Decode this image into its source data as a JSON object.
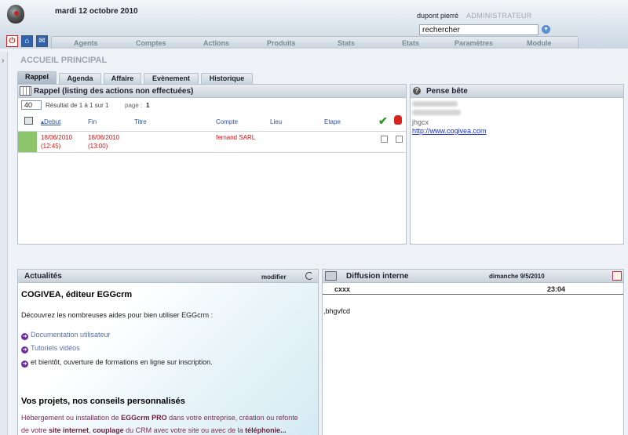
{
  "header": {
    "date": "mardi 12 octobre 2010",
    "user": "dupont pierré",
    "role": "ADMINISTRATEUR",
    "search_value": "rechercher"
  },
  "nav": [
    "Agents",
    "Comptes",
    "Actions",
    "Produits",
    "Stats",
    "Etats",
    "Paramètres",
    "Module"
  ],
  "page_title": "ACCUEIL PRINCIPAL",
  "tabs": [
    "Rappel",
    "Agenda",
    "Affaire",
    "Evènement",
    "Historique"
  ],
  "rappel": {
    "title": "Rappel (listing des actions non effectuées)",
    "count": "40",
    "result": "Résultat de 1 à 1 sur 1",
    "page_label": "page :",
    "page_num": "1",
    "columns": [
      "Debut",
      "Fin",
      "Titre",
      "Compte",
      "Lieu",
      "Etape"
    ],
    "row": {
      "debut_date": "18/06/2010",
      "debut_time": "(12:45)",
      "fin_date": "18/06/2010",
      "fin_time": "(13:00)",
      "compte": "fernand SARL"
    }
  },
  "pense_bete": {
    "title": "Pense bête",
    "text": "jhgcx",
    "link": "http://www.cogivea.com"
  },
  "actualites": {
    "title": "Actualités",
    "modifier": "modifier",
    "heading": "COGIVEA, éditeur EGGcrm",
    "intro": "Découvrez les nombreuses aides pour bien utiliser EGGcrm :",
    "links": [
      "Documentation utilisateur",
      "Tutoriels vidéos"
    ],
    "extra": "et bientôt, ouverture de formations en ligne sur inscription.",
    "heading2": "Vos projets, nos conseils personnalisés",
    "p_line1_a": "Hébergement ou installation de ",
    "p_line1_b": "EGGcrm PRO",
    "p_line1_c": " dans votre entreprise, création ou refonte",
    "p_line2_a": "de votre ",
    "p_line2_b": "site internet",
    "p_line2_c": ", ",
    "p_line2_d": "couplage",
    "p_line2_e": " du CRM avec votre site ou avec de la ",
    "p_line2_f": "téléphonie..."
  },
  "diffusion": {
    "title": "Diffusion interne",
    "date": "dimanche   9/5/2010",
    "sender": "cxxx",
    "time": "23:04",
    "message": ",bhgvfcd"
  },
  "colors": {
    "row_marker": "#8cc56a",
    "alert": "#dd1111",
    "link": "#2b55a6"
  }
}
